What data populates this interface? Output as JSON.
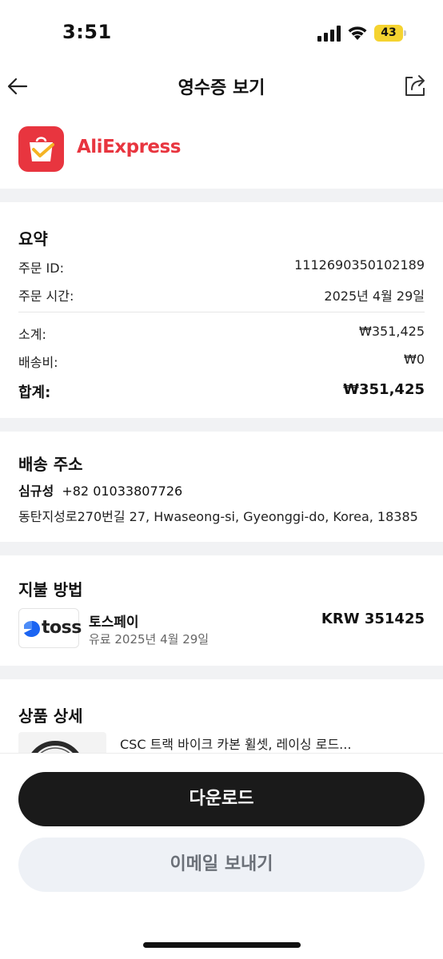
{
  "status": {
    "time": "3:51",
    "battery": "43"
  },
  "nav": {
    "title": "영수증 보기",
    "back_icon": "arrow-left-icon",
    "share_icon": "share-icon"
  },
  "brand": {
    "name": "AliExpress",
    "icon": "aliexpress-bag-icon",
    "color": "#e8353f"
  },
  "summary": {
    "title": "요약",
    "order_id_label": "주문 ID:",
    "order_id": "1112690350102189",
    "order_time_label": "주문 시간:",
    "order_time": "2025년 4월 29일",
    "subtotal_label": "소계:",
    "subtotal": "₩351,425",
    "shipping_label": "배송비:",
    "shipping": "₩0",
    "total_label": "합계:",
    "total": "₩351,425"
  },
  "address": {
    "title": "배송 주소",
    "name": "심규성",
    "phone": "+82 01033807726",
    "line": "동탄지성로270번길 27, Hwaseong-si, Gyeonggi-do, Korea, 18385"
  },
  "payment": {
    "title": "지불 방법",
    "logo_text": "toss",
    "method": "토스페이",
    "date": "유료 2025년 4월 29일",
    "amount": "KRW 351425"
  },
  "product": {
    "title": "상품 상세",
    "name": "CSC 트랙 바이크 카본 휠셋, 레이싱 로드..."
  },
  "actions": {
    "download": "다운로드",
    "email": "이메일 보내기"
  }
}
